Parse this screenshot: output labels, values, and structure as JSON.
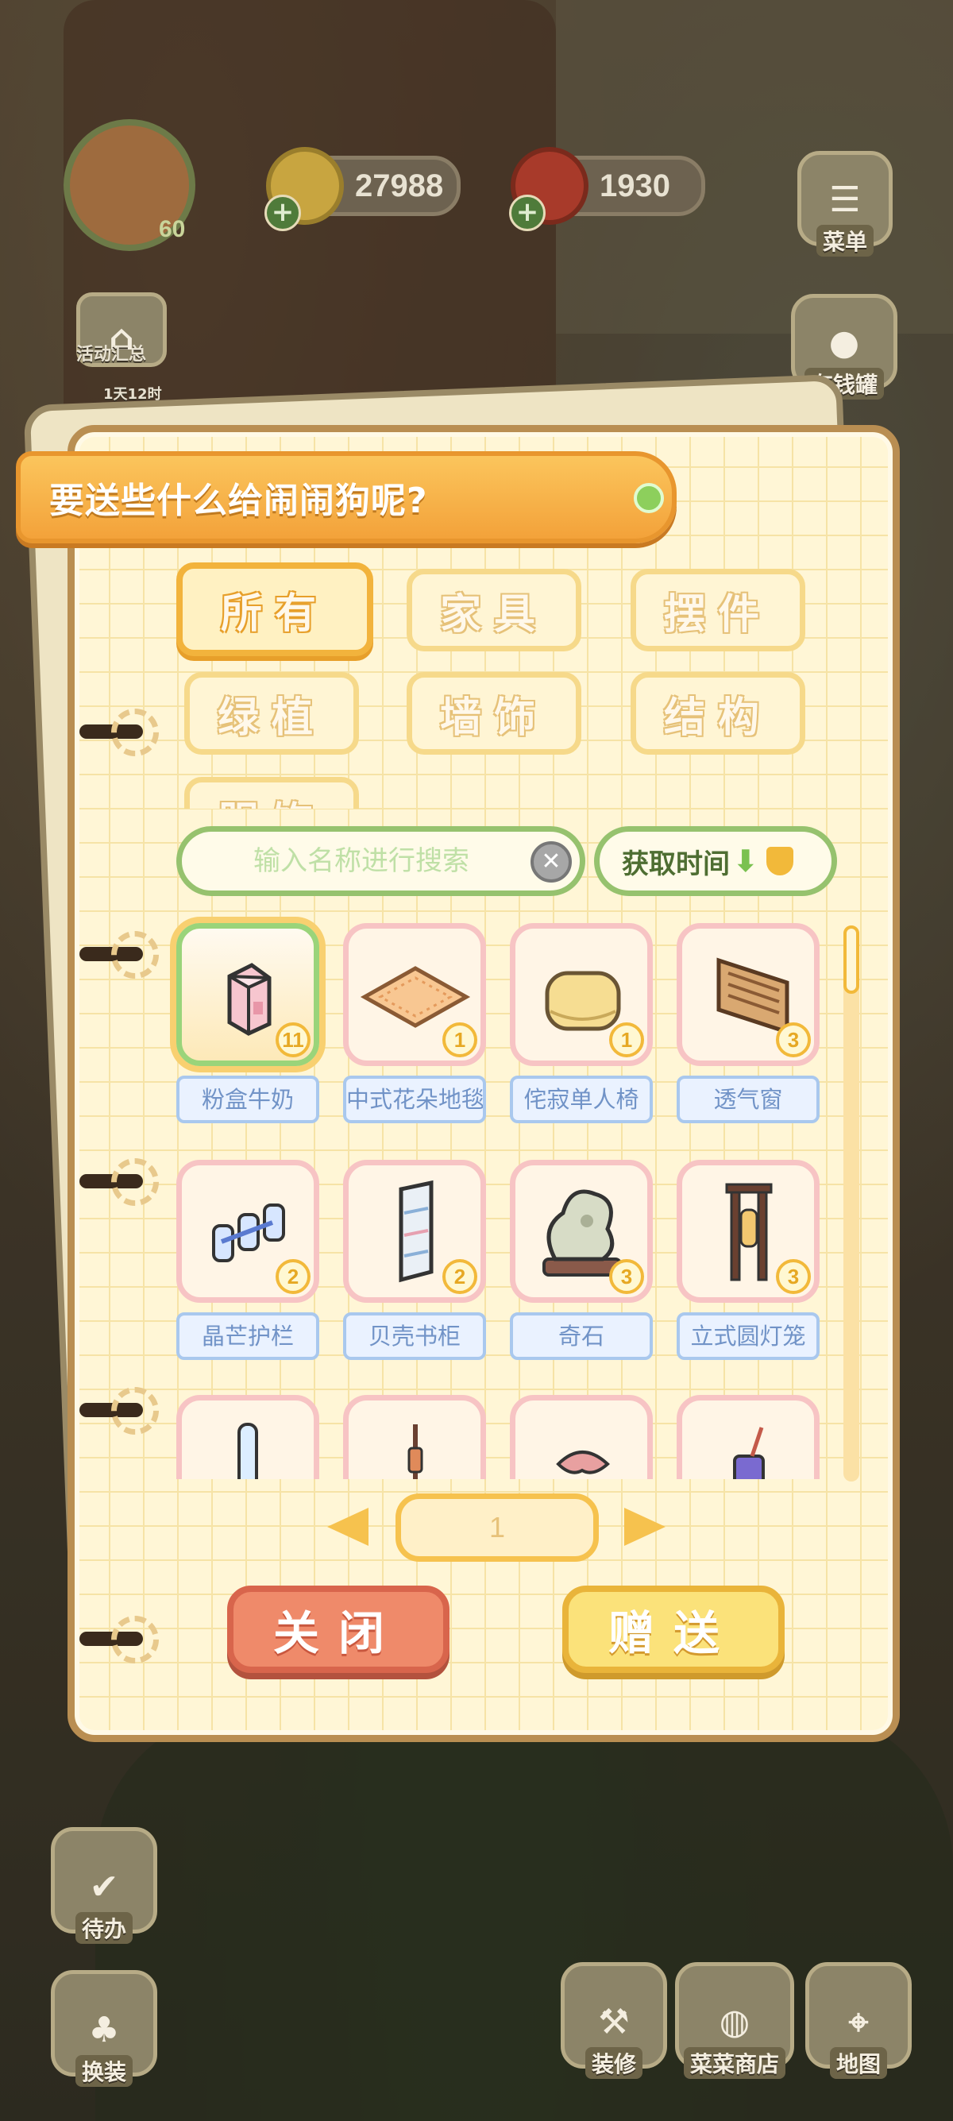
{
  "hud": {
    "level": "60",
    "event_label": "活动汇总",
    "event_timer": "1天12时",
    "coins": "27988",
    "food": "1930",
    "menu_label": "菜单",
    "piggybank_label": "存钱罐",
    "todo_label": "待办",
    "dressup_label": "换装",
    "decorate_label": "装修",
    "shop_label": "菜菜商店",
    "map_label": "地图"
  },
  "dialog": {
    "title": "要送些什么给闹闹狗呢?",
    "categories": [
      "所有",
      "家具",
      "摆件",
      "绿植",
      "墙饰",
      "结构",
      "服饰"
    ],
    "active_category": "所有",
    "search_placeholder": "输入名称进行搜索",
    "sort_label": "获取时间",
    "page": "1",
    "close_label": "关闭",
    "send_label": "赠送"
  },
  "items": [
    {
      "name": "粉盒牛奶",
      "count": "11",
      "icon": "milk-carton-icon"
    },
    {
      "name": "中式花朵地毯",
      "count": "1",
      "icon": "rug-icon"
    },
    {
      "name": "侘寂单人椅",
      "count": "1",
      "icon": "armchair-icon"
    },
    {
      "name": "透气窗",
      "count": "3",
      "icon": "vent-window-icon"
    },
    {
      "name": "晶芒护栏",
      "count": "2",
      "icon": "railing-icon"
    },
    {
      "name": "贝壳书柜",
      "count": "2",
      "icon": "bookshelf-icon"
    },
    {
      "name": "奇石",
      "count": "3",
      "icon": "stone-icon"
    },
    {
      "name": "立式圆灯笼",
      "count": "3",
      "icon": "lantern-icon"
    },
    {
      "name": "",
      "count": "",
      "icon": "glass-pillar-icon"
    },
    {
      "name": "",
      "count": "",
      "icon": "lamp-stand-icon"
    },
    {
      "name": "",
      "count": "",
      "icon": "coral-icon"
    },
    {
      "name": "",
      "count": "",
      "icon": "drink-cup-icon"
    }
  ]
}
